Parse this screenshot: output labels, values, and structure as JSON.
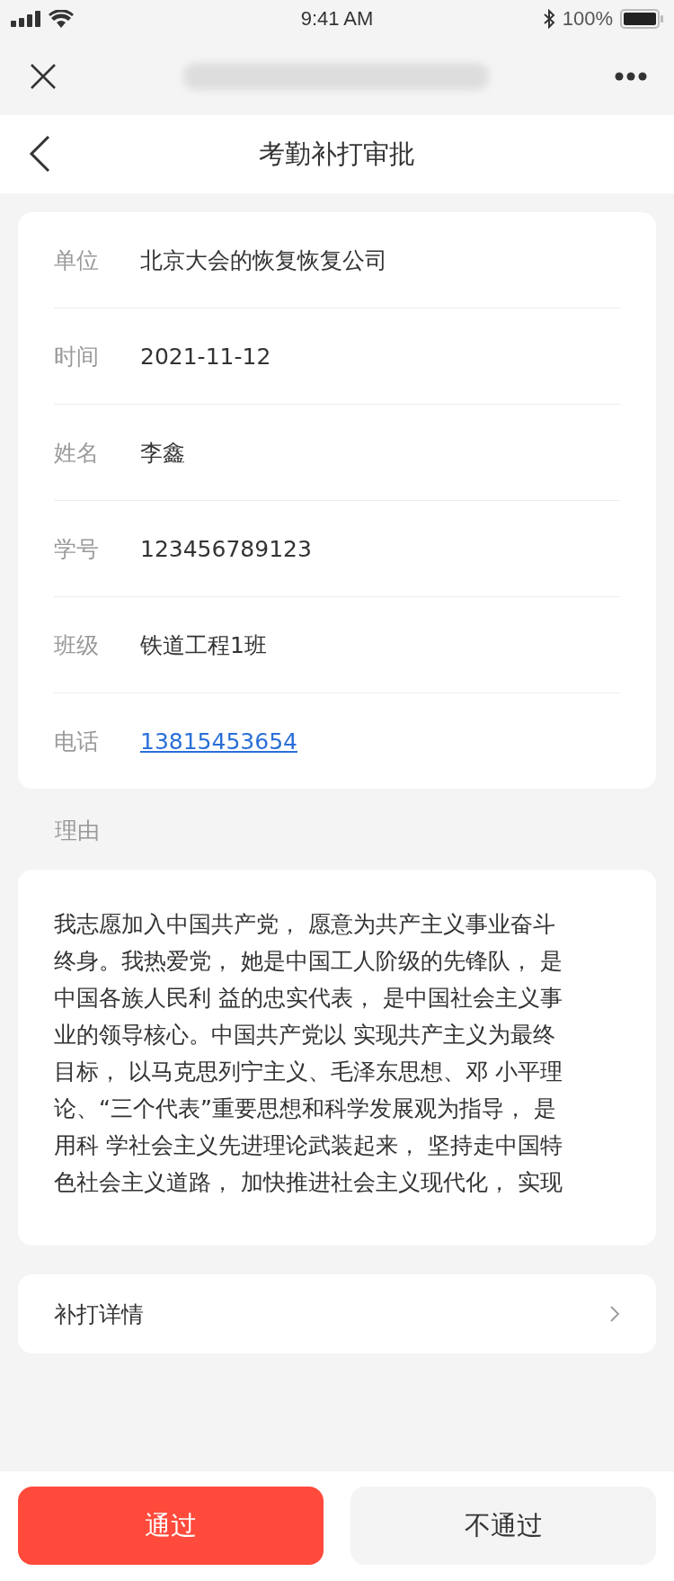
{
  "status_bar": {
    "time": "9:41 AM",
    "battery": "100%"
  },
  "header": {
    "title": "考勤补打审批"
  },
  "info_rows": [
    {
      "label": "单位",
      "value": "北京大会的恢复恢复公司",
      "kind": "text"
    },
    {
      "label": "时间",
      "value": "2021-11-12",
      "kind": "text"
    },
    {
      "label": "姓名",
      "value": "李鑫",
      "kind": "text"
    },
    {
      "label": "学号",
      "value": "123456789123",
      "kind": "text"
    },
    {
      "label": "班级",
      "value": "铁道工程1班",
      "kind": "text"
    },
    {
      "label": "电话",
      "value": "13815453654",
      "kind": "link"
    }
  ],
  "reason": {
    "label": "理由",
    "lines": [
      "我志愿加入中国共产党， 愿意为共产主义事业奋斗",
      "终身。我热爱党， 她是中国工人阶级的先锋队， 是",
      "中国各族人民利 益的忠实代表， 是中国社会主义事",
      "业的领导核心。中国共产党以 实现共产主义为最终",
      "目标， 以马克思列宁主义、毛泽东思想、邓 小平理",
      "论、“三个代表”重要思想和科学发展观为指导， 是",
      "用科 学社会主义先进理论武装起来， 坚持走中国特",
      "色社会主义道路， 加快推进社会主义现代化， 实现"
    ]
  },
  "detail": {
    "label": "补打详情"
  },
  "actions": [
    {
      "label": "通过",
      "kind": "primary"
    },
    {
      "label": "不通过",
      "kind": "secondary"
    }
  ]
}
